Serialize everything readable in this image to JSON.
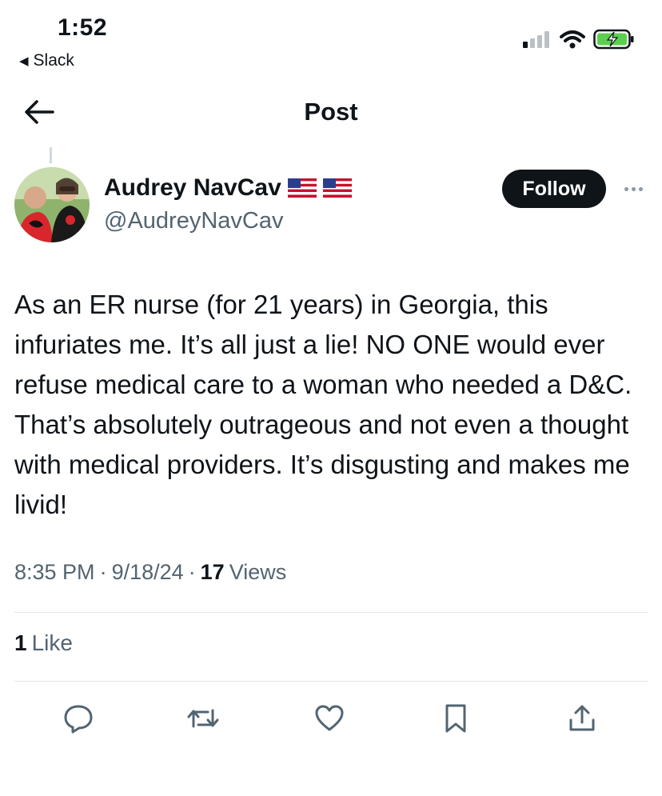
{
  "status_bar": {
    "time": "1:52",
    "back_app": "Slack"
  },
  "nav": {
    "title": "Post"
  },
  "author": {
    "name": "Audrey NavCav",
    "handle": "@AudreyNavCav",
    "follow_label": "Follow"
  },
  "tweet": {
    "text": "As an ER nurse (for 21 years) in Georgia, this infuriates me. It’s all just a lie! NO ONE would ever refuse medical care to a woman who needed a D&C. That’s absolutely outrageous and not even a thought with medical providers. It’s disgusting and makes me livid!",
    "time": "8:35 PM",
    "date": "9/18/24",
    "views_count": "17",
    "views_label": "Views",
    "likes_count": "1",
    "likes_label": "Like"
  },
  "icons": [
    "back-arrow",
    "reply",
    "repost",
    "like",
    "bookmark",
    "share",
    "more"
  ],
  "colors": {
    "text": "#0f1419",
    "secondary": "#536471",
    "follow_bg": "#0f1419"
  }
}
